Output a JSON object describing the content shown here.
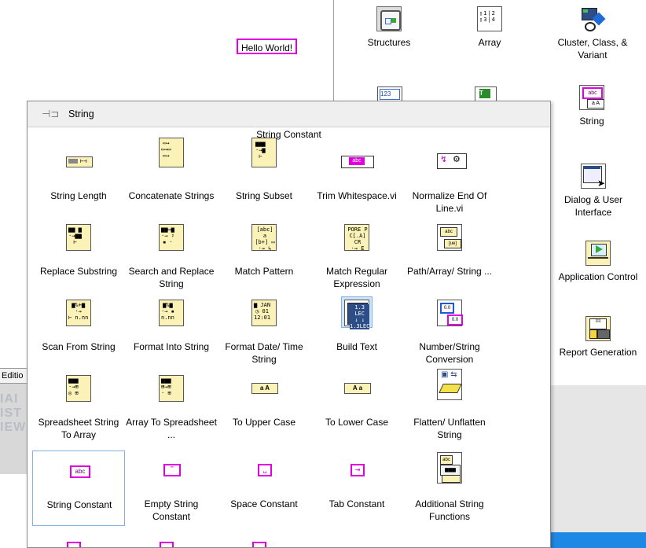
{
  "diagram": {
    "hello_text": "Hello World!"
  },
  "parent_palette": {
    "items": [
      {
        "label": "Structures",
        "icon": "structures-icon"
      },
      {
        "label": "Array",
        "icon": "array-icon"
      },
      {
        "label": "Cluster, Class, & Variant",
        "icon": "cluster-icon"
      },
      {
        "label": "String",
        "icon": "string-icon"
      },
      {
        "label": "Dialog & User Interface",
        "icon": "dialog-icon"
      },
      {
        "label": "Application Control",
        "icon": "app-control-icon"
      },
      {
        "label": "Report Generation",
        "icon": "report-icon"
      }
    ]
  },
  "background_window": {
    "tab_text": "Editio",
    "ghost_lines": [
      "IAI",
      "IST",
      "IEW"
    ]
  },
  "string_palette": {
    "title": "String",
    "tooltip": "String Constant",
    "items": [
      {
        "label": "String Length"
      },
      {
        "label": "Concatenate Strings"
      },
      {
        "label": "String Subset"
      },
      {
        "label": "Trim Whitespace.vi"
      },
      {
        "label": "Normalize End Of Line.vi"
      },
      {
        "label": "Replace Substring"
      },
      {
        "label": "Search and Replace String"
      },
      {
        "label": "Match Pattern"
      },
      {
        "label": "Match Regular Expression"
      },
      {
        "label": "Path/Array/ String ..."
      },
      {
        "label": "Scan From String"
      },
      {
        "label": "Format Into String"
      },
      {
        "label": "Format Date/ Time String"
      },
      {
        "label": "Build Text"
      },
      {
        "label": "Number/String Conversion"
      },
      {
        "label": "Spreadsheet String To Array"
      },
      {
        "label": "Array To Spreadsheet ..."
      },
      {
        "label": "To Upper Case"
      },
      {
        "label": "To Lower Case"
      },
      {
        "label": "Flatten/ Unflatten String"
      },
      {
        "label": "String Constant"
      },
      {
        "label": "Empty String Constant"
      },
      {
        "label": "Space Constant"
      },
      {
        "label": "Tab Constant"
      },
      {
        "label": "Additional String Functions"
      }
    ]
  }
}
